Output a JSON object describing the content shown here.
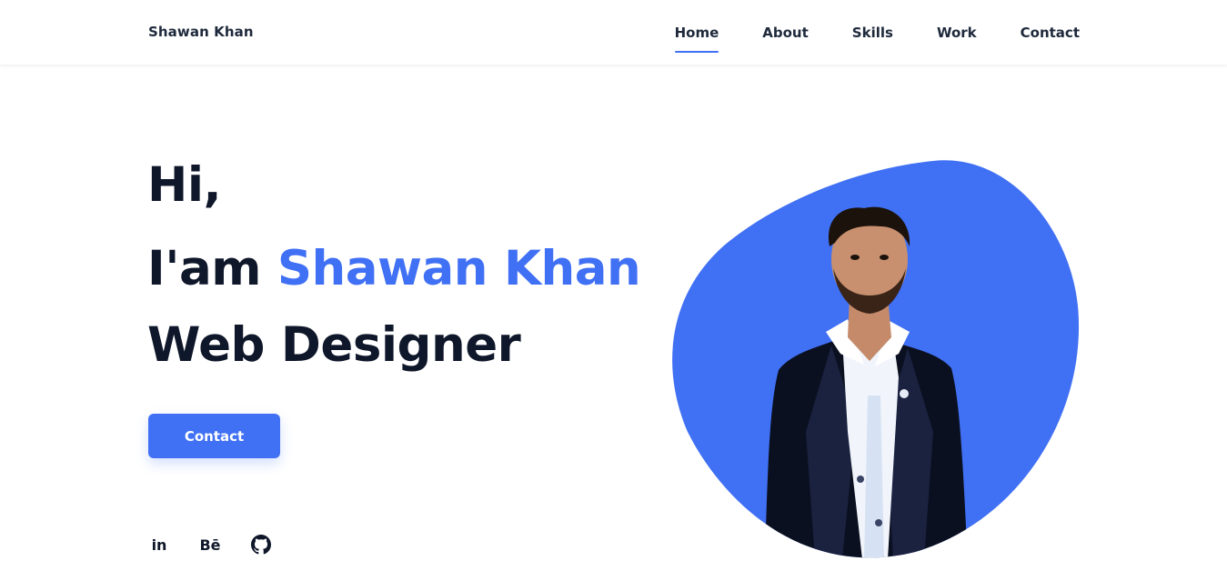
{
  "theme": {
    "accent": "#4070f4",
    "heading": "#0f172a",
    "text": "#1e293b"
  },
  "header": {
    "logo": "Shawan Khan",
    "nav": [
      {
        "label": "Home",
        "active": true
      },
      {
        "label": "About",
        "active": false
      },
      {
        "label": "Skills",
        "active": false
      },
      {
        "label": "Work",
        "active": false
      },
      {
        "label": "Contact",
        "active": false
      }
    ]
  },
  "hero": {
    "greeting": "Hi,",
    "intro_prefix": "I'am",
    "name": "Shawan Khan",
    "role": "Web Designer",
    "cta_label": "Contact"
  },
  "social": [
    {
      "icon": "linkedin-icon",
      "glyph": "in"
    },
    {
      "icon": "behance-icon",
      "glyph": "Bē"
    },
    {
      "icon": "github-icon",
      "glyph": ""
    }
  ],
  "portrait": {
    "description_icon": "profile-photo",
    "blob_color": "#4070f4"
  }
}
